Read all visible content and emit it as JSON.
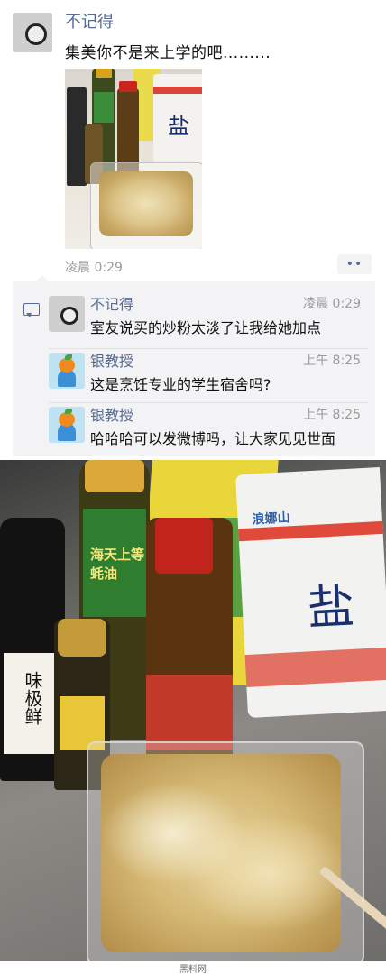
{
  "post": {
    "author": "不记得",
    "text": "集美你不是来上学的吧.........",
    "time": "凌晨 0:29",
    "more_label": "••"
  },
  "comments": [
    {
      "author": "不记得",
      "time": "凌晨 0:29",
      "text": "室友说买的炒粉太淡了让我给她加点"
    },
    {
      "author": "银教授",
      "time": "上午 8:25",
      "text": "这是烹饪专业的学生宿舍吗?"
    },
    {
      "author": "银教授",
      "time": "上午 8:25",
      "text": "哈哈哈可以发微博吗，让大家见见世面"
    }
  ],
  "photo_labels": {
    "left_bottle": "味极鲜",
    "oyster_sauce": "海天上等蚝油",
    "salt_brand": "浪娜山",
    "salt_char": "盐"
  },
  "footer": {
    "watermark": "黑料网"
  }
}
